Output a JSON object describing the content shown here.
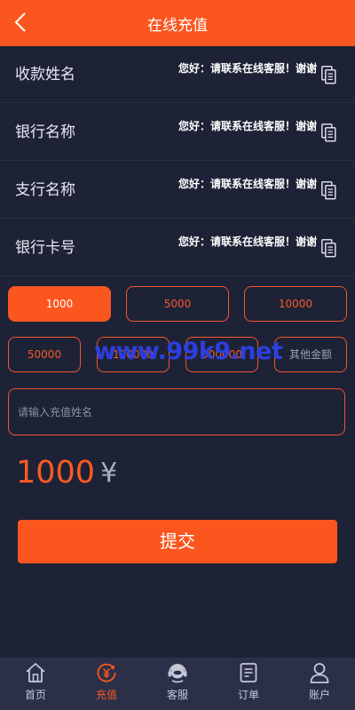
{
  "header": {
    "title": "在线充值"
  },
  "info_rows": [
    {
      "label": "收款姓名",
      "value": "您好：请联系在线客服！谢谢"
    },
    {
      "label": "银行名称",
      "value": "您好：请联系在线客服！谢谢"
    },
    {
      "label": "支行名称",
      "value": "您好：请联系在线客服！谢谢"
    },
    {
      "label": "银行卡号",
      "value": "您好：请联系在线客服！谢谢"
    }
  ],
  "amount_options": [
    "1000",
    "5000",
    "10000",
    "50000",
    "100000",
    "500000"
  ],
  "other_amount_placeholder": "其他金额",
  "name_placeholder": "请输入充值姓名",
  "selected_amount": "1000",
  "currency_symbol": "¥",
  "submit_label": "提交",
  "watermark": "www.99k9.net",
  "tabs": [
    {
      "label": "首页",
      "icon": "home-icon"
    },
    {
      "label": "充值",
      "icon": "recharge-icon",
      "active": true
    },
    {
      "label": "客服",
      "icon": "customer-service-icon"
    },
    {
      "label": "订单",
      "icon": "order-icon"
    },
    {
      "label": "账户",
      "icon": "account-icon"
    }
  ],
  "colors": {
    "accent": "#fb561e",
    "background": "#1e2236",
    "tabbar": "#2b3048"
  }
}
